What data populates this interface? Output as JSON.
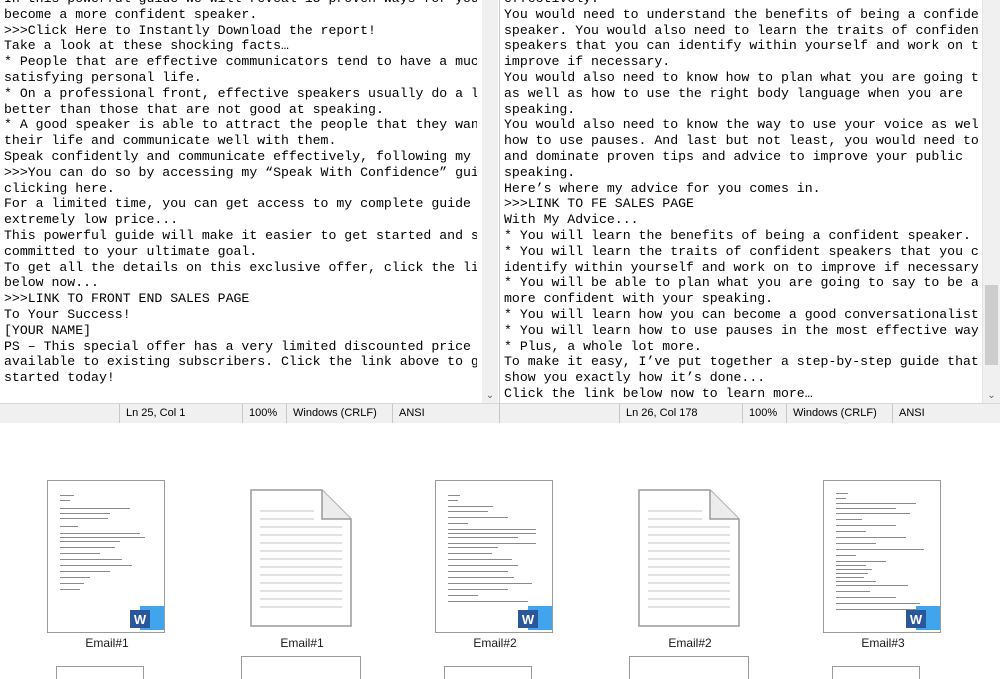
{
  "left_editor": {
    "lines": [
      "In this powerful guide we will reveal 15 proven ways for you to",
      "become a more confident speaker.",
      ">>>Click Here to Instantly Download the report!",
      "Take a look at these shocking facts…",
      "* People that are effective communicators tend to have a much more",
      "satisfying personal life.",
      "* On a professional front, effective speakers usually do a lot",
      "better than those that are not good at speaking.",
      "* A good speaker is able to attract the people that they want in",
      "their life and communicate well with them.",
      "Speak confidently and communicate effectively, following my advice",
      ">>>You can do so by accessing my “Speak With Confidence” guide",
      "clicking here.",
      "For a limited time, you can get access to my complete guide at an",
      "extremely low price...",
      "This powerful guide will make it easier to get started and stay",
      "committed to your ultimate goal.",
      "To get all the details on this exclusive offer, click the link",
      "below now...",
      ">>>LINK TO FRONT END SALES PAGE",
      "To Your Success!",
      "[YOUR NAME]",
      "PS – This special offer has a very limited discounted price only",
      "available to existing subscribers. Click the link above to get",
      "started today!"
    ],
    "status": {
      "position": "Ln 25, Col 1",
      "zoom": "100%",
      "line_endings": "Windows (CRLF)",
      "encoding": "ANSI"
    }
  },
  "right_editor": {
    "lines": [
      "effectively.",
      "You would need to understand the benefits of being a confident",
      "speaker. You would also need to learn the traits of confident",
      "speakers that you can identify within yourself and work on to",
      "improve if necessary.",
      "You would also need to know how to plan what you are going to say,",
      "as well as how to use the right body language when you are",
      "speaking.",
      "You would also need to know the way to use your voice as well as",
      "how to use pauses. And last but not least, you would need to learn",
      "and dominate proven tips and advice to improve your public",
      "speaking.",
      "Here’s where my advice for you comes in.",
      ">>>LINK TO FE SALES PAGE",
      "With My Advice...",
      "* You will learn the benefits of being a confident speaker.",
      "* You will learn the traits of confident speakers that you can",
      "identify within yourself and work on to improve if necessary.",
      "* You will be able to plan what you are going to say to be a lot",
      "more confident with your speaking.",
      "* You will learn how you can become a good conversationalist.",
      "* You will learn how to use pauses in the most effective way.",
      "* Plus, a whole lot more.",
      "To make it easy, I’ve put together a step-by-step guide that will",
      "show you exactly how it’s done...",
      "Click the link below now to learn more…"
    ],
    "status": {
      "position": "Ln 26, Col 178",
      "zoom": "100%",
      "line_endings": "Windows (CRLF)",
      "encoding": "ANSI"
    }
  },
  "files": [
    {
      "label": "Email#1",
      "icon": "word-document-icon"
    },
    {
      "label": "Email#1",
      "icon": "text-file-icon"
    },
    {
      "label": "Email#2",
      "icon": "word-document-icon"
    },
    {
      "label": "Email#2",
      "icon": "text-file-icon"
    },
    {
      "label": "Email#3",
      "icon": "word-document-icon"
    }
  ],
  "colors": {
    "word_blue": "#2b579a",
    "word_light": "#41a5ee",
    "scroll_bg": "#f0f0f0"
  }
}
